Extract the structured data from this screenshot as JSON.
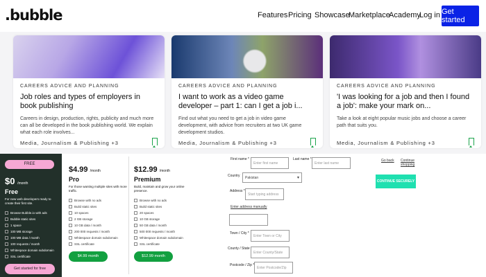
{
  "nav": {
    "logo": ".bubble",
    "links": [
      "Features",
      "Pricing",
      "Showcase",
      "Marketplace",
      "Academy",
      "Log in"
    ],
    "cta": "Get started"
  },
  "cards": [
    {
      "eyebrow": "CAREERS ADVICE AND PLANNING",
      "title": "Job roles and types of employers in book publishing",
      "excerpt": "Careers in design, production, rights, publicity and much more can all be developed in the book publishing world. We explain what each role involves...",
      "tag": "Media, Journalism & Publishing +3"
    },
    {
      "eyebrow": "CAREERS ADVICE AND PLANNING",
      "title": "I want to work as a video game developer – part 1: can I get a job i...",
      "excerpt": "Find out what you need to get a job in video game development, with advice from recruiters at two UK game development studios.",
      "tag": "Media, Journalism & Publishing +3"
    },
    {
      "eyebrow": "CAREERS ADVICE AND PLANNING",
      "title": "'I was looking for a job and then I found a job': make your mark on...",
      "excerpt": "Take a look at eight popular music jobs and choose a career path that suits you.",
      "tag": "Media, Journalism & Publishing +3"
    }
  ],
  "pricing": {
    "free": {
      "badge": "FREE",
      "price": "$0",
      "period": "/month",
      "name": "Free",
      "desc": "For new web developers ready to create their first site.",
      "features": [
        "Browse Bubble.io with ads",
        "Bubble static sites",
        "1 space",
        "100 MB storage",
        "100 MB data / month",
        "100 requests / month",
        "Whitespace domain subdomain",
        "SSL certificate"
      ],
      "button": "Get started for free"
    },
    "pro": {
      "price": "$4.99",
      "period": "/month",
      "name": "Pro",
      "desc": "For those wanting multiple sites with more traffic.",
      "features": [
        "Browse with no ads",
        "Build static sites",
        "10 spaces",
        "2 GB storage",
        "10 GB data / month",
        "200 000 requests / month",
        "Whitespace domain subdomain",
        "SSL certificate"
      ],
      "button": "$4.99 month"
    },
    "premium": {
      "price": "$12.99",
      "period": "/month",
      "name": "Premium",
      "desc": "Build, maintain and grow your online presence.",
      "features": [
        "Browse with no ads",
        "Build static sites",
        "20 spaces",
        "10 GB storage",
        "50 GB data / month",
        "500 000 requests / month",
        "Whitespace domain subdomain",
        "SSL certificate"
      ],
      "button": "$12.99 month"
    }
  },
  "form": {
    "first_name_label": "First name *",
    "first_name_placeholder": "Enter first name",
    "last_name_label": "Last name *",
    "last_name_placeholder": "Enter last name",
    "country_label": "Country",
    "country_value": "Pakistan",
    "address_label": "Address *",
    "address_placeholder": "Start typing address",
    "manual_link": "Enter address manually",
    "town_label": "Town / City *",
    "town_placeholder": "Enter Town or City",
    "county_label": "County / State",
    "county_placeholder": "Enter County/State",
    "postcode_label": "Postcode / Zip *",
    "postcode_placeholder": "Enter Postcode/Zip",
    "links": [
      "Go back",
      "Continue shopping"
    ],
    "pay_button": "CONTINUE SECURELY"
  },
  "colors": {
    "cta_blue": "#0a22e6",
    "free_bg": "#22302a",
    "free_pink": "#f6a8d4",
    "green": "#12a040",
    "teal": "#1fe0b0"
  }
}
